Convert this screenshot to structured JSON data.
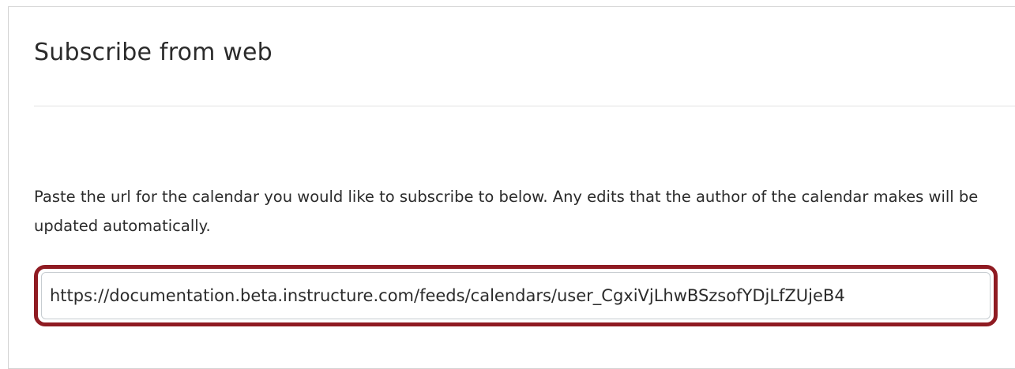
{
  "dialog": {
    "title": "Subscribe from web",
    "instructions": "Paste the url for the calendar you would like to subscribe to below. Any edits that the author of the calendar makes will be updated automatically.",
    "url_input": {
      "value": "https://documentation.beta.instructure.com/feeds/calendars/user_CgxiVjLhwBSzsofYDjLfZUjeB4",
      "placeholder": ""
    }
  },
  "colors": {
    "highlight_border": "#8f1b22",
    "text": "#2b2b2b",
    "divider": "#e2e2e2"
  }
}
